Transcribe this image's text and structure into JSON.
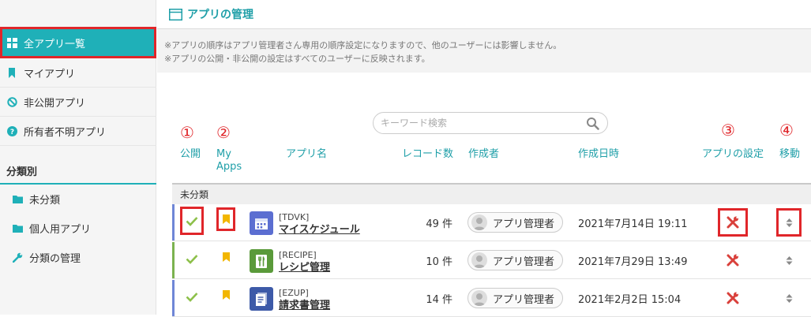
{
  "header": {
    "title": "アプリの管理"
  },
  "sidebar": {
    "items": [
      {
        "label": "全アプリ一覧",
        "icon": "grid-icon"
      },
      {
        "label": "マイアプリ",
        "icon": "bookmark-icon"
      },
      {
        "label": "非公開アプリ",
        "icon": "prohibited-icon"
      },
      {
        "label": "所有者不明アプリ",
        "icon": "question-icon"
      }
    ],
    "section_label": "分類別",
    "categories": [
      {
        "label": "未分類",
        "icon": "folder-icon"
      },
      {
        "label": "個人用アプリ",
        "icon": "folder-icon"
      },
      {
        "label": "分類の管理",
        "icon": "wrench-icon"
      }
    ]
  },
  "notice": {
    "line1": "※アプリの順序はアプリ管理者さん専用の順序設定になりますので、他のユーザーには影響しません。",
    "line2": "※アプリの公開・非公開の設定はすべてのユーザーに反映されます。"
  },
  "search": {
    "placeholder": "キーワード検索"
  },
  "markers": [
    "①",
    "②",
    "③",
    "④"
  ],
  "columns": {
    "public": "公開",
    "myapps_1": "My",
    "myapps_2": "Apps",
    "name": "アプリ名",
    "records": "レコード数",
    "creator": "作成者",
    "created": "作成日時",
    "settings": "アプリの設定",
    "move": "移動"
  },
  "group": {
    "label": "未分類"
  },
  "rows": [
    {
      "code": "[TDVK]",
      "name": "マイスケジュール",
      "records": "49 件",
      "creator": "アプリ管理者",
      "created": "2021年7月14日 19:11",
      "icon": "calendar-icon",
      "icon_color": "#5b6ed1",
      "bar_color": "#6f86d6"
    },
    {
      "code": "[RECIPE]",
      "name": "レシピ管理",
      "records": "10 件",
      "creator": "アプリ管理者",
      "created": "2021年7月29日 13:49",
      "icon": "recipe-icon",
      "icon_color": "#5a9a3a",
      "bar_color": "#7bb24f"
    },
    {
      "code": "[EZUP]",
      "name": "請求書管理",
      "records": "14 件",
      "creator": "アプリ管理者",
      "created": "2021年2月2日 15:04",
      "icon": "invoice-icon",
      "icon_color": "#3d5aa8",
      "bar_color": "#6f86d6"
    }
  ],
  "colors": {
    "accent": "#1fb0b8",
    "check": "#8dc04a",
    "bookmark": "#f2b600",
    "tool": "#d9403b",
    "highlight": "#e0262a"
  }
}
